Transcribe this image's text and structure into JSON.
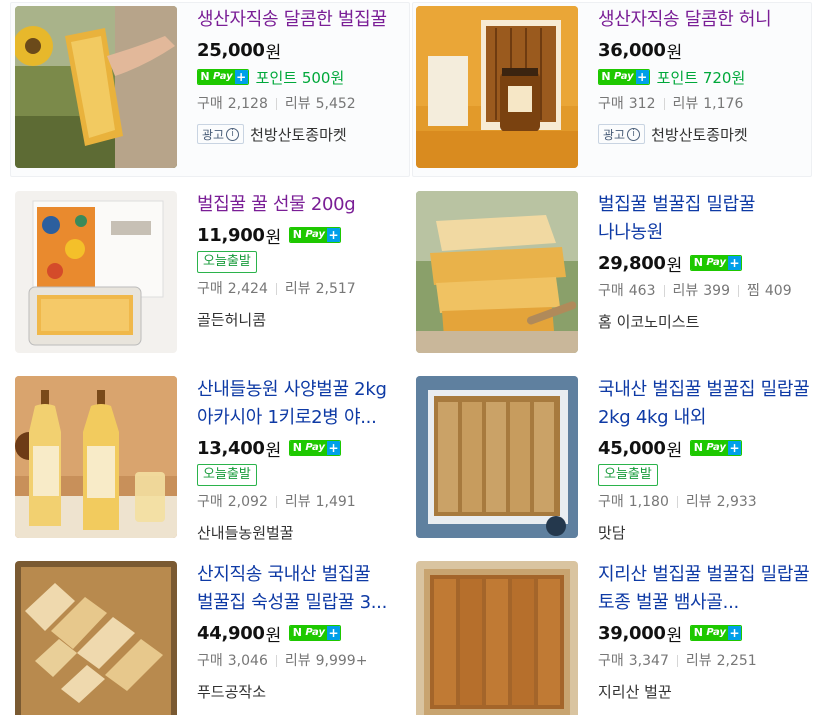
{
  "labels": {
    "won": "원",
    "npay_n": "N",
    "npay_pay": "Pay",
    "npay_plus": "+",
    "purchases": "구매",
    "reviews": "리뷰",
    "wishes": "찜",
    "ad": "광고",
    "info": "i",
    "today_ship": "오늘출발"
  },
  "colors": {
    "title_link": "#0e3aa5",
    "title_visited": "#7a1e96",
    "naver_green": "#1ec800",
    "point_green": "#00a83a"
  },
  "products": [
    {
      "title": "생산자직송 달콤한 벌집꿀",
      "price": "25,000",
      "point": "포인트 500원",
      "purchases": "2,128",
      "reviews": "5,452",
      "seller": "천방산토종마켓"
    },
    {
      "title": "생산자직송 달콤한 허니",
      "price": "36,000",
      "point": "포인트 720원",
      "purchases": "312",
      "reviews": "1,176",
      "seller": "천방산토종마켓"
    },
    {
      "title": "벌집꿀 꿀 선물 200g",
      "price": "11,900",
      "badge": "오늘출발",
      "purchases": "2,424",
      "reviews": "2,517",
      "seller": "골든허니콤"
    },
    {
      "title": "벌집꿀 벌꿀집 밀랍꿀 나나농원",
      "price": "29,800",
      "purchases": "463",
      "reviews": "399",
      "wishes": "409",
      "seller": "홈 이코노미스트"
    },
    {
      "title": "산내들농원 사양벌꿀 2kg 아카시아 1키로2병 야...",
      "price": "13,400",
      "badge": "오늘출발",
      "purchases": "2,092",
      "reviews": "1,491",
      "seller": "산내들농원벌꿀"
    },
    {
      "title": "국내산 벌집꿀 벌꿀집 밀랍꿀 2kg 4kg 내외",
      "price": "45,000",
      "badge": "오늘출발",
      "purchases": "1,180",
      "reviews": "2,933",
      "seller": "맛담"
    },
    {
      "title": "산지직송 국내산 벌집꿀 벌꿀집 숙성꿀 밀랍꿀 3...",
      "price": "44,900",
      "purchases": "3,046",
      "reviews": "9,999+",
      "seller": "푸드공작소"
    },
    {
      "title": "지리산 벌집꿀 벌꿀집 밀랍꿀 토종 벌꿀 뱀사골...",
      "price": "39,000",
      "purchases": "3,347",
      "reviews": "2,251",
      "seller": "지리산 벌꾼"
    }
  ]
}
